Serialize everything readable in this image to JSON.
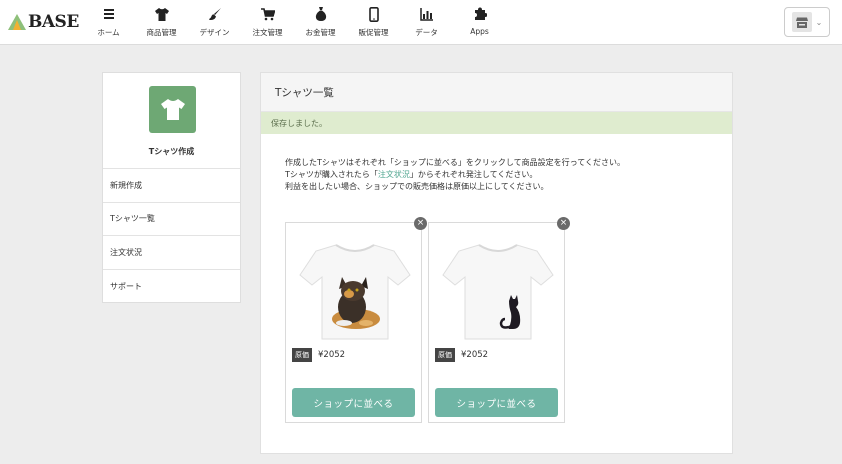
{
  "logo": {
    "text": "BASE"
  },
  "nav": {
    "items": [
      {
        "label": "ホーム",
        "icon": "home-list-icon"
      },
      {
        "label": "商品管理",
        "icon": "tshirt-icon"
      },
      {
        "label": "デザイン",
        "icon": "paintbrush-icon"
      },
      {
        "label": "注文管理",
        "icon": "cart-icon"
      },
      {
        "label": "お金管理",
        "icon": "money-bag-icon"
      },
      {
        "label": "販促管理",
        "icon": "smartphone-icon"
      },
      {
        "label": "データ",
        "icon": "bar-chart-icon"
      },
      {
        "label": "Apps",
        "icon": "puzzle-icon"
      }
    ]
  },
  "sidebar": {
    "app_name": "Tシャツ作成",
    "items": [
      {
        "label": "新規作成"
      },
      {
        "label": "Tシャツ一覧"
      },
      {
        "label": "注文状況"
      },
      {
        "label": "サポート"
      }
    ]
  },
  "main": {
    "title": "Tシャツ一覧",
    "alert": "保存しました。",
    "intro": {
      "line1": "作成したTシャツはそれぞれ「ショップに並べる」をクリックして商品設定を行ってください。",
      "line2_before": "Tシャツが購入されたら「",
      "line2_link": "注文状況",
      "line2_after": "」からそれぞれ発注してください。",
      "line3": "利益を出したい場合、ショップでの販売価格は原価以上にしてください。"
    },
    "products": [
      {
        "badge": "原価",
        "price": "¥2052",
        "button": "ショップに並べる",
        "image": "tshirt-calico-cat"
      },
      {
        "badge": "原価",
        "price": "¥2052",
        "button": "ショップに並べる",
        "image": "tshirt-black-cat"
      }
    ]
  },
  "colors": {
    "accent": "#6fb5a5",
    "alert_bg": "#dfeccf",
    "app_logo": "#6ea874"
  }
}
